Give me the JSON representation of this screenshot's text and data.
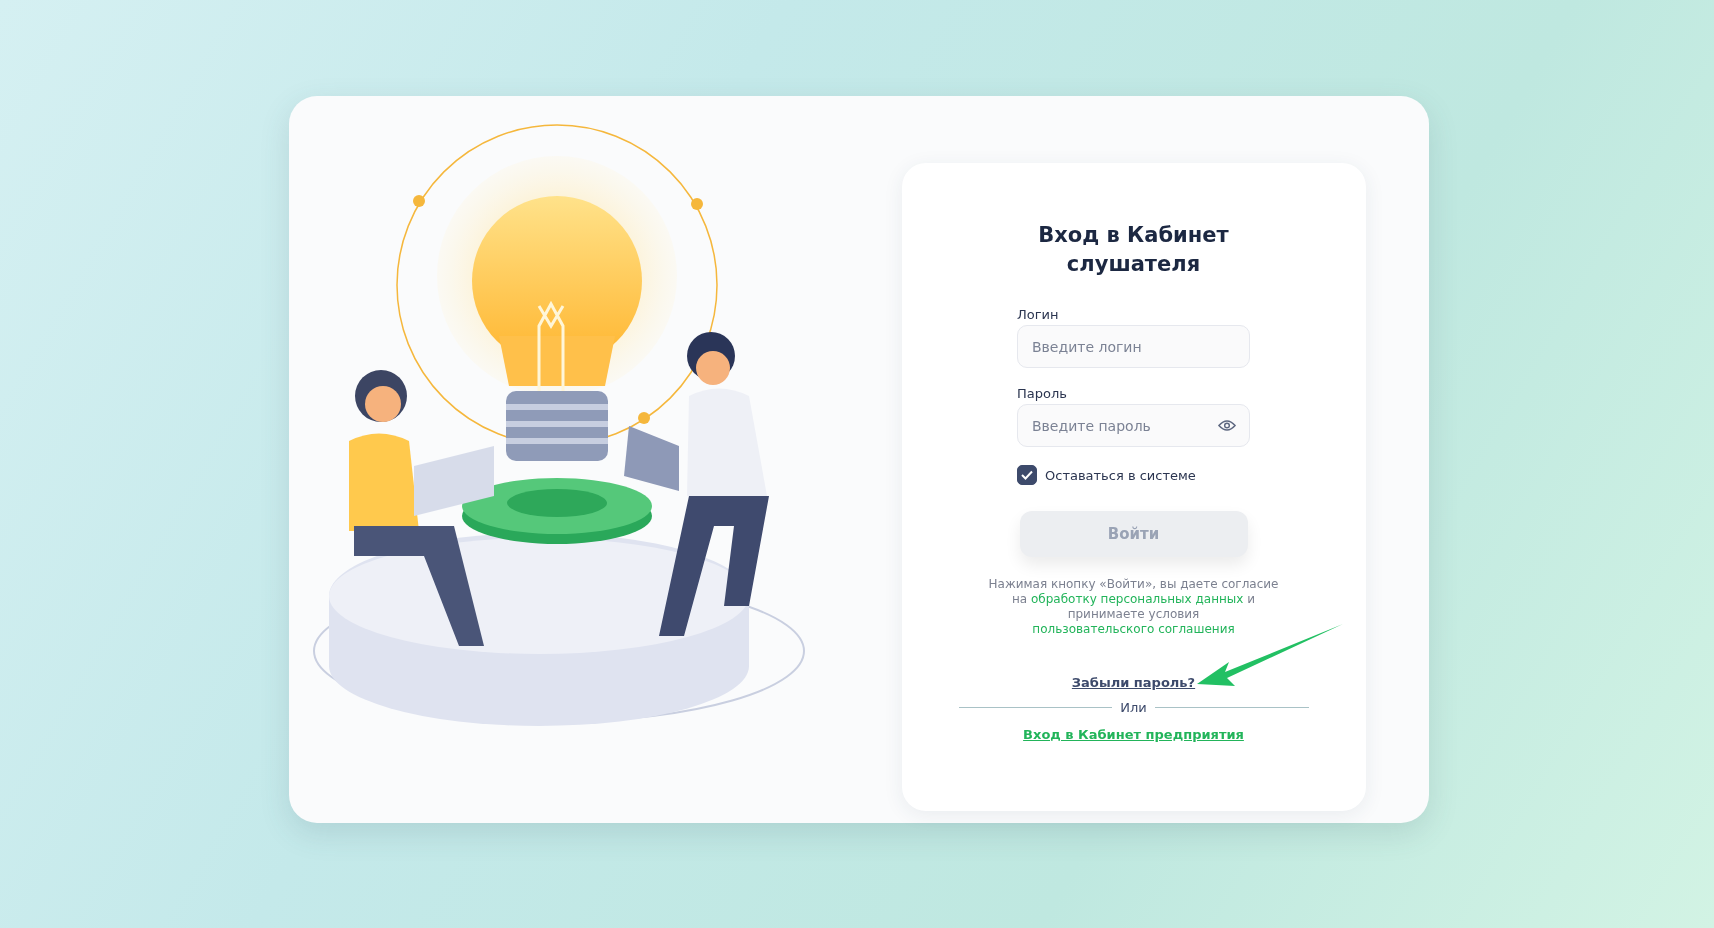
{
  "title": "Вход в Кабинет слушателя",
  "fields": [
    {
      "label": "Логин",
      "placeholder": "Введите логин",
      "kind": "text"
    },
    {
      "label": "Пароль",
      "placeholder": "Введите пароль",
      "kind": "password"
    }
  ],
  "remember": {
    "label": "Оставаться в системе",
    "checked": true
  },
  "submit": {
    "label": "Войти",
    "disabled": true
  },
  "consent": [
    {
      "kind": "plain",
      "text": "Нажимая кнопку «Войти», вы даете согласие на"
    },
    {
      "kind": "link",
      "text": "обработку персональных данных"
    },
    {
      "kind": "plain",
      "text": "и принимаете условия"
    },
    {
      "kind": "link",
      "text": "пользовательского соглашения"
    }
  ],
  "forgot_link": "Забыли пароль?",
  "divider": "Или",
  "enterprise_link": "Вход в Кабинет предприятия"
}
